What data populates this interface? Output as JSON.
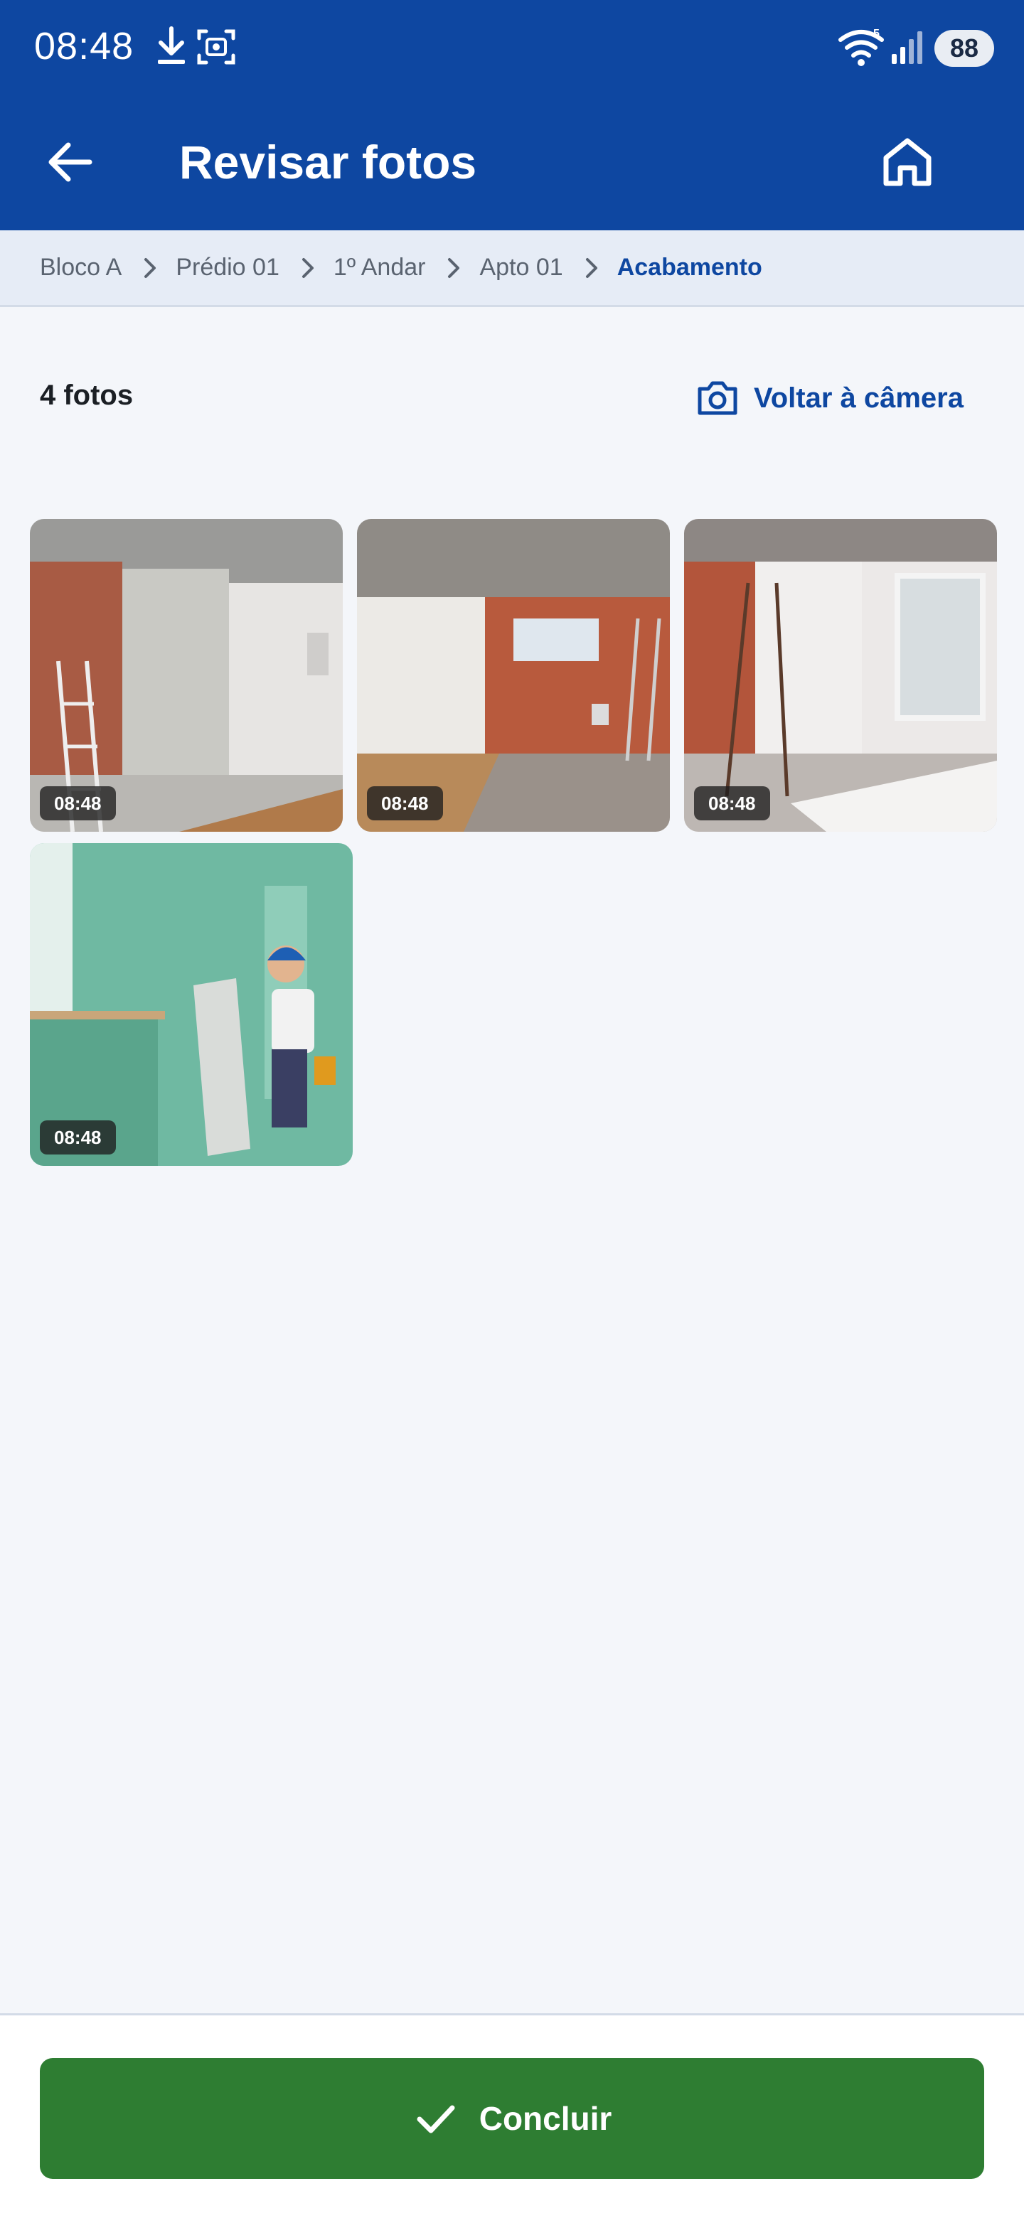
{
  "status_bar": {
    "time": "08:48",
    "battery": "88",
    "icons": [
      "download-icon",
      "screenshot-icon",
      "wifi-icon",
      "signal-icon",
      "battery-icon"
    ]
  },
  "app_bar": {
    "title": "Revisar fotos",
    "back_icon": "arrow-left-icon",
    "home_icon": "home-icon"
  },
  "breadcrumb": {
    "items": [
      {
        "label": "Bloco A"
      },
      {
        "label": "Prédio 01"
      },
      {
        "label": "1º Andar"
      },
      {
        "label": "Apto 01"
      },
      {
        "label": "Acabamento"
      }
    ],
    "separator_icon": "chevron-right-icon"
  },
  "gallery": {
    "count_label": "4 fotos",
    "camera_button_label": "Voltar à câmera",
    "camera_icon": "camera-icon",
    "photos": [
      {
        "time": "08:48"
      },
      {
        "time": "08:48"
      },
      {
        "time": "08:48"
      },
      {
        "time": "08:48"
      }
    ]
  },
  "footer": {
    "conclude_label": "Concluir",
    "conclude_icon": "check-icon"
  },
  "colors": {
    "primary": "#0e47a1",
    "success": "#2e7d32",
    "background": "#f4f6fa"
  }
}
